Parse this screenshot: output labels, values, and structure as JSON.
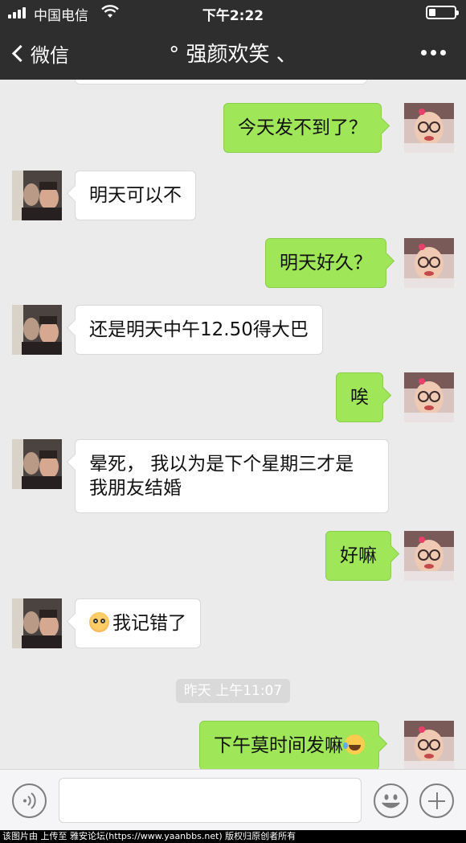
{
  "status_bar": {
    "carrier": "中国电信",
    "time": "下午2:22"
  },
  "nav": {
    "back_label": "微信",
    "title": "° 强颜欢笑 、"
  },
  "messages": [
    {
      "side": "right",
      "text": "今天发不到了？"
    },
    {
      "side": "left",
      "text": "明天可以不"
    },
    {
      "side": "right",
      "text": "明天好久？"
    },
    {
      "side": "left",
      "text": "还是明天中午12.50得大巴"
    },
    {
      "side": "right",
      "text": "唉"
    },
    {
      "side": "left",
      "text_line1": "晕死， 我以为是下个星期三才是",
      "text_line2": "我朋友结婚"
    },
    {
      "side": "right",
      "text": "好嘛"
    },
    {
      "side": "left",
      "text": "我记错了",
      "emoji": "flushed-face-icon"
    },
    {
      "side": "right",
      "text": "下午莫时间发嘛",
      "emoji": "laughing-tears-icon"
    }
  ],
  "timestamp": "昨天 上午11:07",
  "watermark": "该图片由  上传至 雅安论坛(https://www.yaanbbs.net) 版权归原创者所有"
}
